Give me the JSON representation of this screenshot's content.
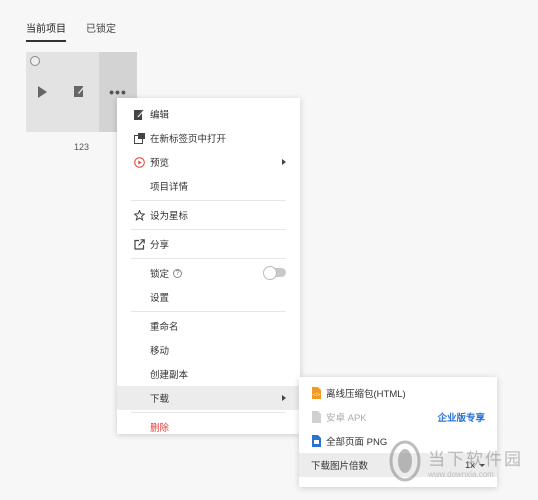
{
  "tabs": [
    {
      "label": "当前项目",
      "active": true
    },
    {
      "label": "已锁定",
      "active": false
    }
  ],
  "project": {
    "title": "123",
    "more_label": "•••"
  },
  "menu": {
    "edit": "编辑",
    "open_new_tab": "在新标签页中打开",
    "preview": "预览",
    "details": "项目详情",
    "star": "设为星标",
    "share": "分享",
    "lock": "锁定",
    "lock_help": "?",
    "settings": "设置",
    "rename": "重命名",
    "move": "移动",
    "duplicate": "创建副本",
    "download": "下载",
    "delete": "删除"
  },
  "submenu": {
    "html_zip": "离线压缩包(HTML)",
    "apk": "安卓 APK",
    "apk_badge": "企业版专享",
    "png": "全部页面 PNG",
    "scale_label": "下载图片倍数",
    "scale_value": "1x"
  },
  "watermark": {
    "cn": "当下软件园",
    "url": "www.downxia.com"
  },
  "colors": {
    "danger": "#e0403a",
    "accent": "#2a72d9",
    "html_icon": "#f29a1f",
    "png_icon": "#2a72d9"
  }
}
